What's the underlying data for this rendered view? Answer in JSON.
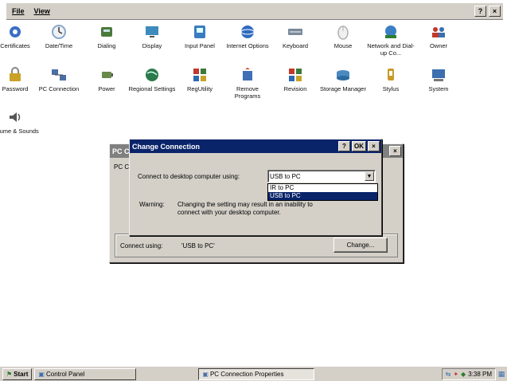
{
  "menubar": {
    "items": [
      {
        "label": "File",
        "icon": "file-menu"
      },
      {
        "label": "View",
        "icon": "view-menu"
      }
    ],
    "help_label": "?",
    "close_label": "×"
  },
  "icons": [
    {
      "label": "Certificates",
      "icon": "certificates-icon",
      "color": "#3a6fc4"
    },
    {
      "label": "Date/Time",
      "icon": "date-time-icon",
      "color": "#8aa6c9"
    },
    {
      "label": "Dialing",
      "icon": "dialing-icon",
      "color": "#4a7a3a"
    },
    {
      "label": "Display",
      "icon": "display-icon",
      "color": "#3d8bbd"
    },
    {
      "label": "Input Panel",
      "icon": "input-panel-icon",
      "color": "#3b7cc0"
    },
    {
      "label": "Internet Options",
      "icon": "internet-options-icon",
      "color": "#2f6ac0"
    },
    {
      "label": "Keyboard",
      "icon": "keyboard-icon",
      "color": "#7a8a9a"
    },
    {
      "label": "Mouse",
      "icon": "mouse-icon",
      "color": "#b0b0b0"
    },
    {
      "label": "Network and Dial-up Co...",
      "icon": "network-icon",
      "color": "#2e7d32"
    },
    {
      "label": "Owner",
      "icon": "owner-icon",
      "color": "#c0392b"
    },
    {
      "label": "Password",
      "icon": "password-icon",
      "color": "#c9a227"
    },
    {
      "label": "PC Connection",
      "icon": "pc-connection-icon",
      "color": "#4a6fa5"
    },
    {
      "label": "Power",
      "icon": "power-icon",
      "color": "#6a8a4a"
    },
    {
      "label": "Regional Settings",
      "icon": "regional-settings-icon",
      "color": "#2b7a4b"
    },
    {
      "label": "RegUtility",
      "icon": "regutility-icon",
      "color": "#3a7a3a"
    },
    {
      "label": "Remove Programs",
      "icon": "remove-programs-icon",
      "color": "#3f6fb5"
    },
    {
      "label": "Revision",
      "icon": "revision-icon",
      "color": "#3a7a3a"
    },
    {
      "label": "Storage Manager",
      "icon": "storage-manager-icon",
      "color": "#4a8ac0"
    },
    {
      "label": "Stylus",
      "icon": "stylus-icon",
      "color": "#c99a27"
    },
    {
      "label": "System",
      "icon": "system-icon",
      "color": "#3b6fb0"
    },
    {
      "label": "Volume & Sounds",
      "icon": "volume-sounds-icon",
      "color": "#555555"
    }
  ],
  "pc_window": {
    "title": "PC C",
    "tab_label": "PC C",
    "close_label": "×",
    "connect_label": "Connect using:",
    "connect_value": "'USB to PC'",
    "change_button": "Change..."
  },
  "dialog": {
    "title": "Change Connection",
    "help_label": "?",
    "ok_label": "OK",
    "close_label": "×",
    "connect_label": "Connect to desktop computer using:",
    "combo_value": "USB to PC",
    "options": [
      "IR to PC",
      "USB to PC"
    ],
    "warning_label": "Warning:",
    "warning_text_1": "Changing the setting may result in an inability to",
    "warning_text_2": "connect with your desktop computer."
  },
  "taskbar": {
    "start_label": "Start",
    "tasks": [
      {
        "label": "Control Panel"
      },
      {
        "label": "PC Connection Properties"
      }
    ],
    "clock": "3:38 PM"
  },
  "colors": {
    "active_title": "#0a246a",
    "inactive_title": "#808080",
    "face": "#d4d0c8"
  }
}
